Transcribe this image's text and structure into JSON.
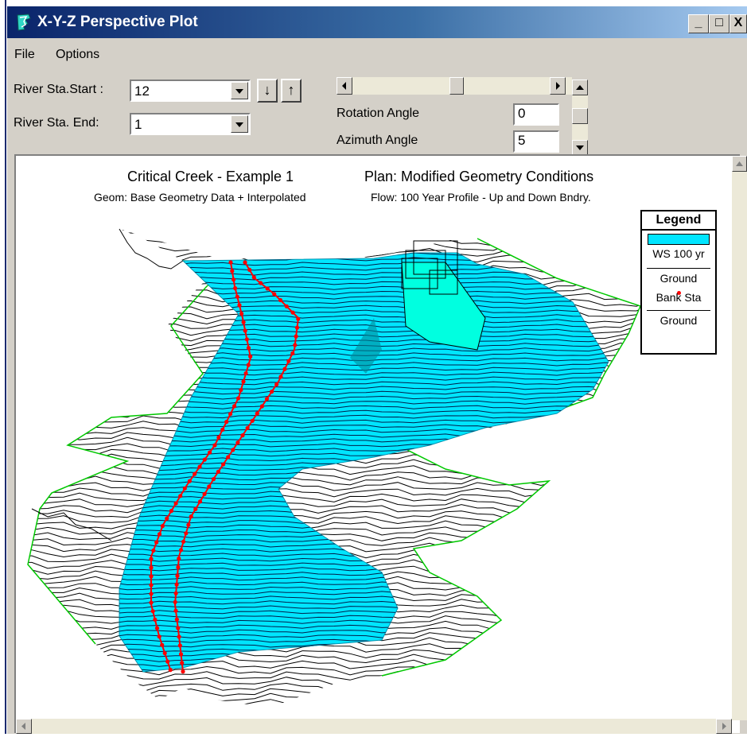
{
  "window": {
    "title": "X-Y-Z Perspective Plot",
    "minimize_label": "_",
    "maximize_label": "□",
    "close_label": "X"
  },
  "menu": {
    "file": "File",
    "options": "Options"
  },
  "controls": {
    "start_label": "River Sta.Start :",
    "start_value": "12",
    "end_label": "River Sta. End:",
    "end_value": "1",
    "down_arrow": "↓",
    "up_arrow": "↑",
    "rotation_label": "Rotation Angle",
    "rotation_value": "0",
    "azimuth_label": "Azimuth Angle",
    "azimuth_value": "5"
  },
  "plot": {
    "title": "Critical Creek - Example 1",
    "plan": "Plan: Modified Geometry Conditions",
    "geom": "Geom: Base Geometry Data + Interpolated",
    "flow": "Flow: 100 Year Profile - Up and Down Bndry.",
    "legend": {
      "title": "Legend",
      "items": [
        "WS 100 yr",
        "Ground",
        "Bank Sta",
        "Ground"
      ]
    }
  },
  "colors": {
    "water": "#00e5ff",
    "ground_outline": "#00c800",
    "bank_station": "#ff0000",
    "titlebar_start": "#0a246a",
    "titlebar_end": "#a6caf0"
  }
}
